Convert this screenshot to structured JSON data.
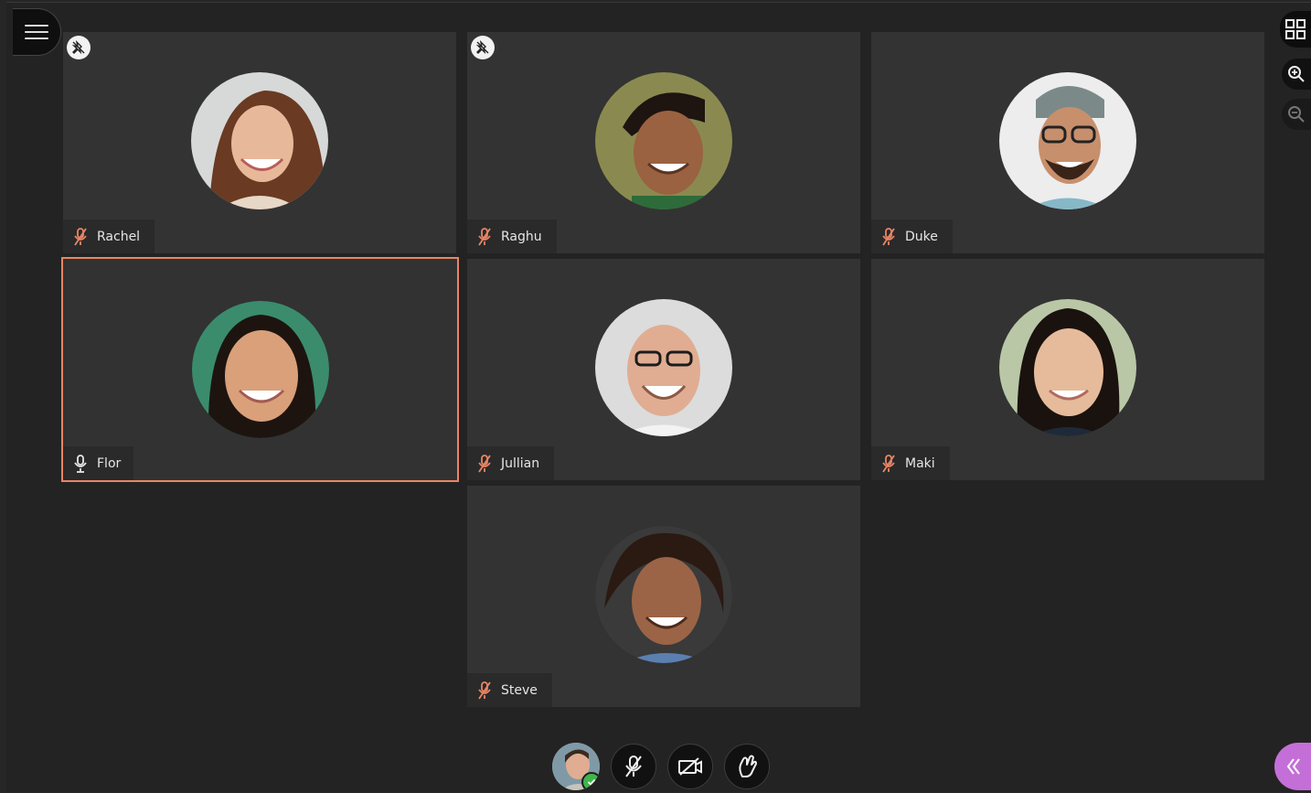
{
  "participants": [
    {
      "name": "Rachel",
      "mic": "muted",
      "pinned": true
    },
    {
      "name": "Raghu",
      "mic": "muted",
      "pinned": true
    },
    {
      "name": "Duke",
      "mic": "muted",
      "pinned": false
    },
    {
      "name": "Flor",
      "mic": "on",
      "pinned": false,
      "active_speaker": true
    },
    {
      "name": "Jullian",
      "mic": "muted",
      "pinned": false
    },
    {
      "name": "Maki",
      "mic": "muted",
      "pinned": false
    },
    {
      "name": "Steve",
      "mic": "muted",
      "pinned": false
    }
  ],
  "colors": {
    "active_border": "#e98565",
    "muted_icon": "#e98565",
    "collaborate_panel": "#c46fd8",
    "status_ok": "#3fb54a"
  },
  "controls": {
    "self_status": "check-icon",
    "icons": [
      "microphone-muted-icon",
      "camera-off-icon",
      "raise-hand-icon"
    ]
  },
  "rail_icons": [
    "grid-view-icon",
    "zoom-in-icon",
    "zoom-out-icon"
  ]
}
